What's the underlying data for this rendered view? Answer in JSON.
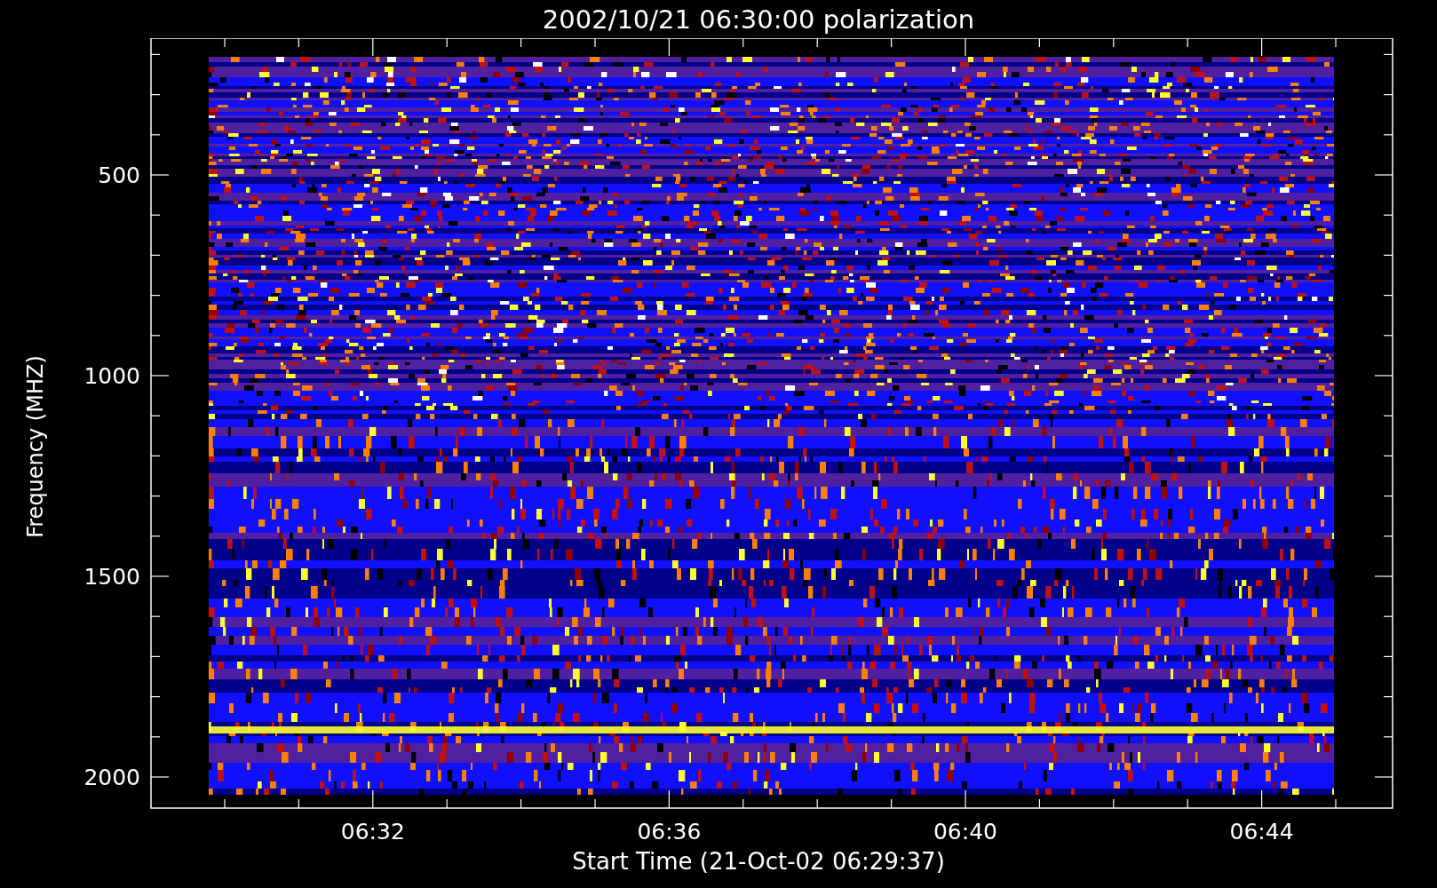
{
  "plot": {
    "title": "2002/10/21 06:30:00 polarization",
    "y_axis": {
      "label": "Frequency (MHZ)",
      "ticks": [
        "500",
        "1000",
        "1500",
        "2000"
      ]
    },
    "x_axis": {
      "label": "Start Time (21-Oct-02 06:29:37)",
      "ticks": [
        "06:32",
        "06:36",
        "06:40",
        "06:44"
      ]
    }
  }
}
